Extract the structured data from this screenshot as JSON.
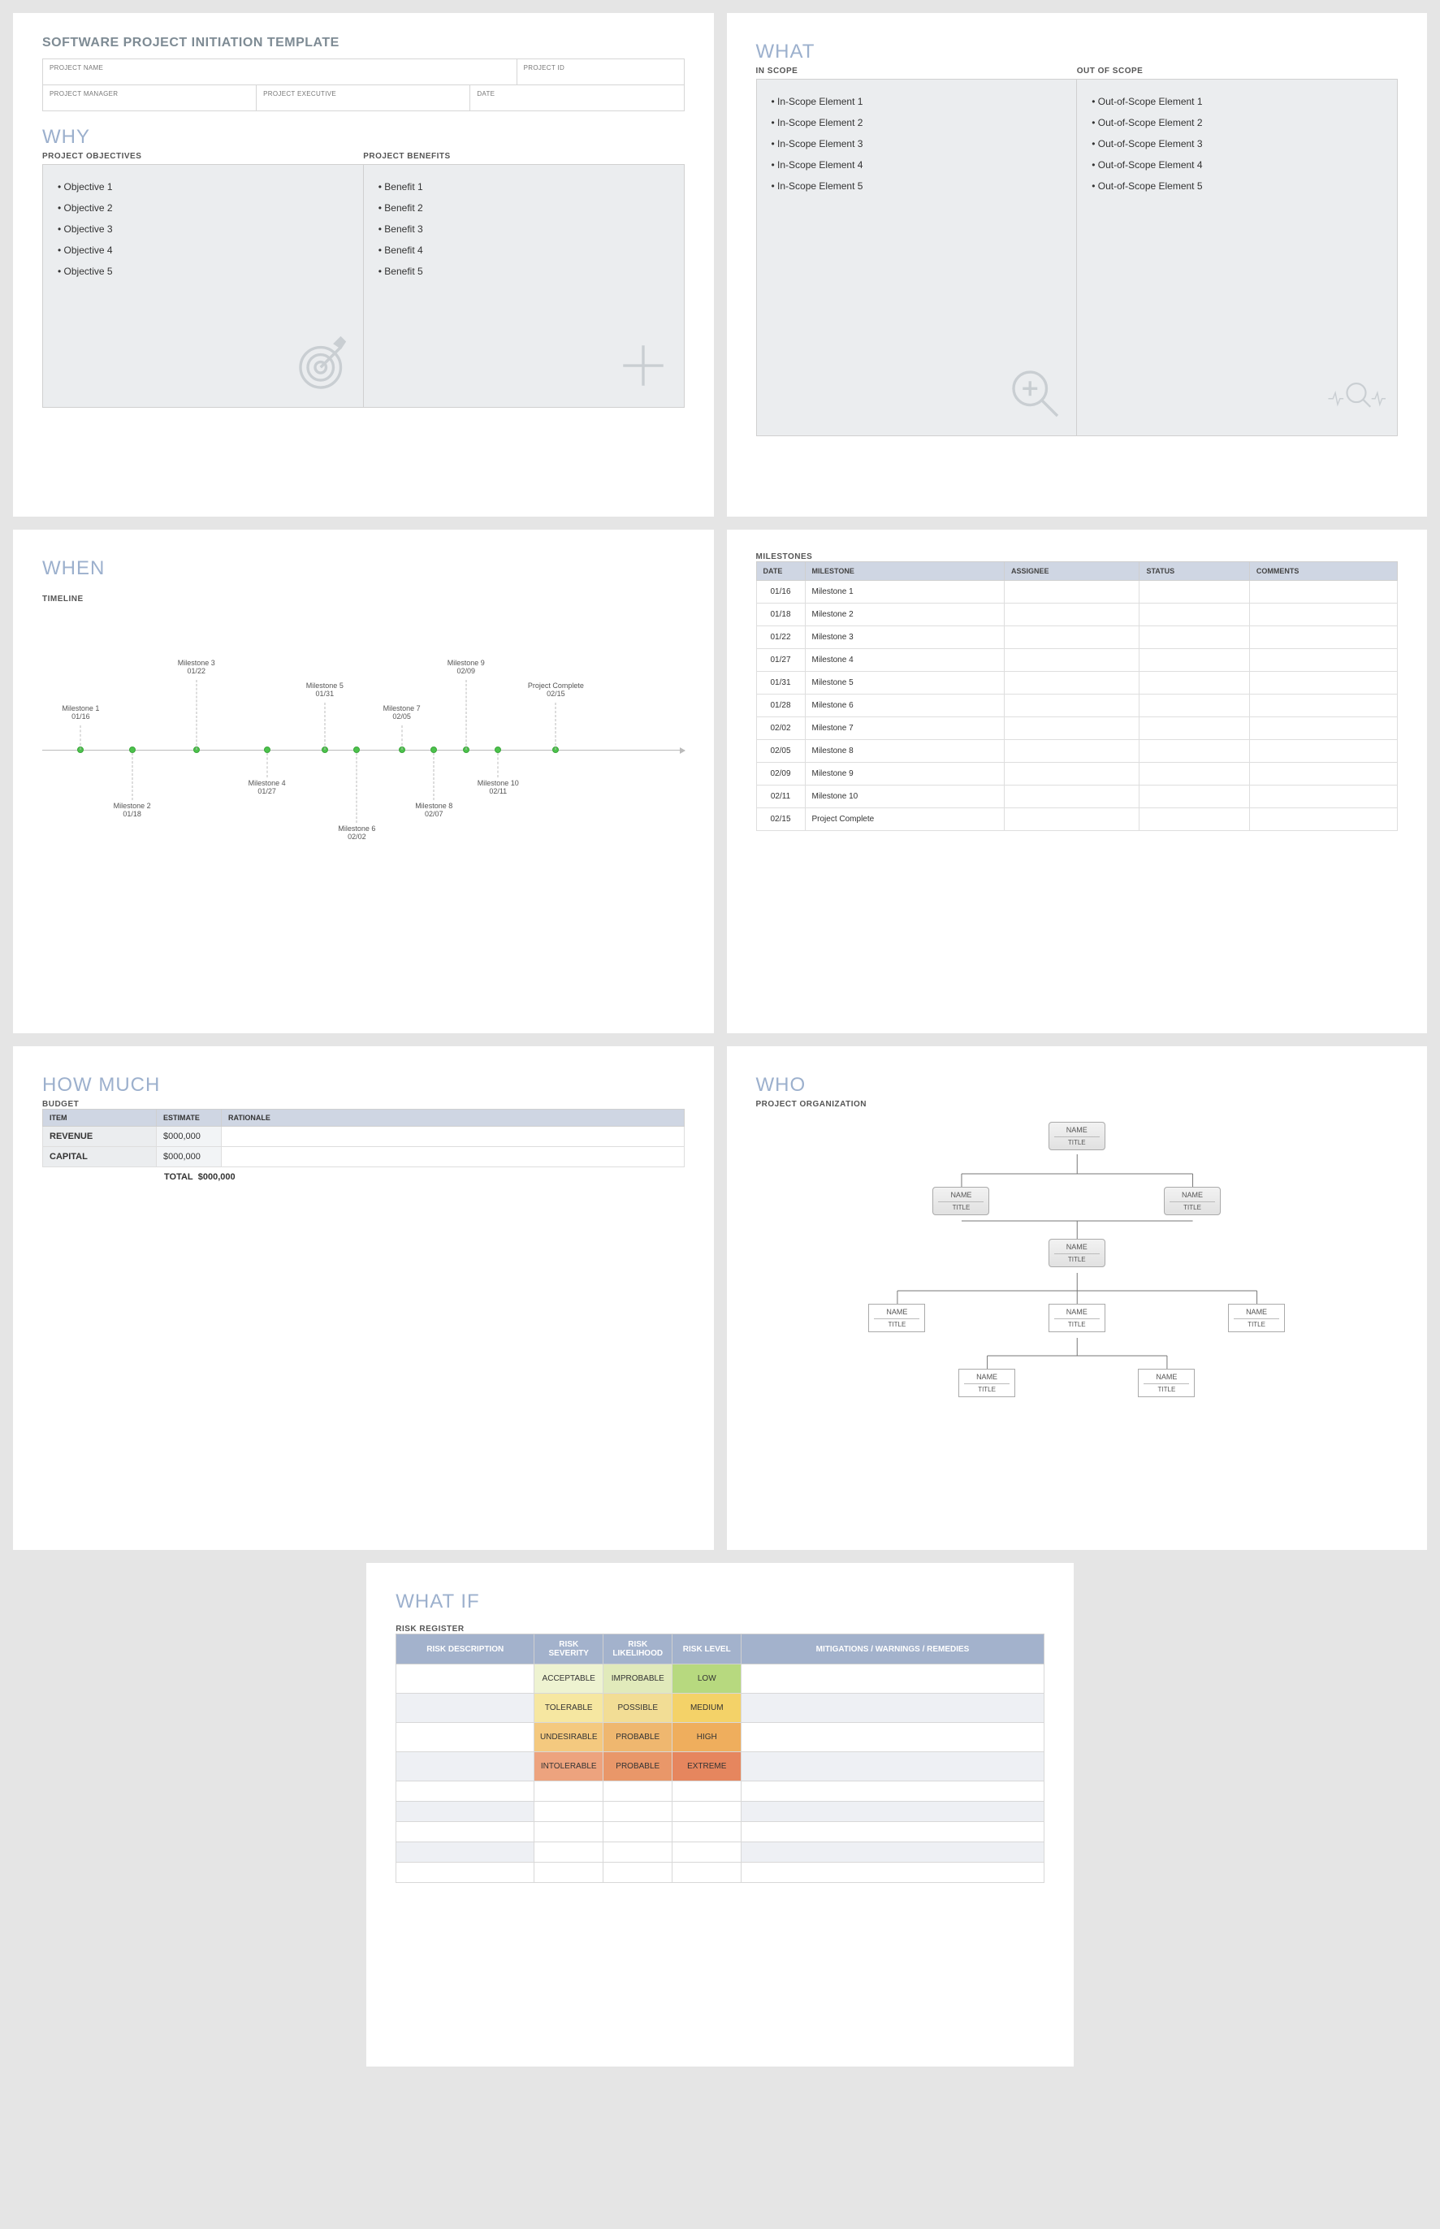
{
  "docTitle": "SOFTWARE PROJECT INITIATION TEMPLATE",
  "hdr": {
    "projectName": "PROJECT NAME",
    "projectId": "PROJECT ID",
    "projectManager": "PROJECT MANAGER",
    "projectExecutive": "PROJECT EXECUTIVE",
    "date": "DATE"
  },
  "why": {
    "title": "WHY",
    "objLabel": "PROJECT OBJECTIVES",
    "benLabel": "PROJECT BENEFITS",
    "objectives": [
      "Objective 1",
      "Objective 2",
      "Objective 3",
      "Objective 4",
      "Objective 5"
    ],
    "benefits": [
      "Benefit 1",
      "Benefit 2",
      "Benefit 3",
      "Benefit 4",
      "Benefit 5"
    ]
  },
  "what": {
    "title": "WHAT",
    "inLabel": "IN SCOPE",
    "outLabel": "OUT OF SCOPE",
    "inscope": [
      "In-Scope Element 1",
      "In-Scope Element 2",
      "In-Scope Element 3",
      "In-Scope Element 4",
      "In-Scope Element 5"
    ],
    "outscope": [
      "Out-of-Scope Element 1",
      "Out-of-Scope Element 2",
      "Out-of-Scope Element 3",
      "Out-of-Scope Element 4",
      "Out-of-Scope Element 5"
    ]
  },
  "when": {
    "title": "WHEN",
    "timelineLabel": "TIMELINE",
    "milestonesLabel": "MILESTONES",
    "cols": {
      "date": "DATE",
      "milestone": "MILESTONE",
      "assignee": "ASSIGNEE",
      "status": "STATUS",
      "comments": "COMMENTS"
    },
    "items": [
      {
        "date": "01/16",
        "name": "Milestone 1",
        "pos": 6,
        "side": "up"
      },
      {
        "date": "01/18",
        "name": "Milestone 2",
        "pos": 14,
        "side": "down"
      },
      {
        "date": "01/22",
        "name": "Milestone 3",
        "pos": 24,
        "side": "up"
      },
      {
        "date": "01/27",
        "name": "Milestone 4",
        "pos": 35,
        "side": "down"
      },
      {
        "date": "01/31",
        "name": "Milestone 5",
        "pos": 44,
        "side": "up"
      },
      {
        "date": "02/02",
        "name": "Milestone 6",
        "pos": 49,
        "side": "down"
      },
      {
        "date": "02/05",
        "name": "Milestone 7",
        "pos": 56,
        "side": "up"
      },
      {
        "date": "02/07",
        "name": "Milestone 8",
        "pos": 61,
        "side": "down"
      },
      {
        "date": "02/09",
        "name": "Milestone 9",
        "pos": 66,
        "side": "up"
      },
      {
        "date": "02/11",
        "name": "Milestone 10",
        "pos": 71,
        "side": "down"
      },
      {
        "date": "02/15",
        "name": "Project Complete",
        "pos": 80,
        "side": "up"
      }
    ]
  },
  "howmuch": {
    "title": "HOW MUCH",
    "budgetLabel": "BUDGET",
    "cols": {
      "item": "ITEM",
      "estimate": "ESTIMATE",
      "rationale": "RATIONALE"
    },
    "rows": [
      {
        "item": "REVENUE",
        "estimate": "$000,000",
        "rationale": ""
      },
      {
        "item": "CAPITAL",
        "estimate": "$000,000",
        "rationale": ""
      }
    ],
    "totalLabel": "TOTAL",
    "totalValue": "$000,000"
  },
  "who": {
    "title": "WHO",
    "orgLabel": "PROJECT ORGANIZATION",
    "name": "NAME",
    "ttl": "TITLE"
  },
  "whatif": {
    "title": "WHAT IF",
    "regLabel": "RISK REGISTER",
    "cols": {
      "desc": "RISK DESCRIPTION",
      "sev": "RISK SEVERITY",
      "lik": "RISK LIKELIHOOD",
      "lvl": "RISK LEVEL",
      "mit": "MITIGATIONS / WARNINGS / REMEDIES"
    },
    "rows": [
      {
        "sev": "ACCEPTABLE",
        "sevc": "sev-acc",
        "lik": "IMPROBABLE",
        "likc": "lik-imp",
        "lvl": "LOW",
        "lvlc": "lvl-low"
      },
      {
        "sev": "TOLERABLE",
        "sevc": "sev-tol",
        "lik": "POSSIBLE",
        "likc": "lik-pos",
        "lvl": "MEDIUM",
        "lvlc": "lvl-med"
      },
      {
        "sev": "UNDESIRABLE",
        "sevc": "sev-und",
        "lik": "PROBABLE",
        "likc": "lik-pro1",
        "lvl": "HIGH",
        "lvlc": "lvl-hig"
      },
      {
        "sev": "INTOLERABLE",
        "sevc": "sev-int",
        "lik": "PROBABLE",
        "likc": "lik-pro2",
        "lvl": "EXTREME",
        "lvlc": "lvl-ext"
      }
    ],
    "emptyRows": 5
  },
  "chart_data": {
    "type": "table",
    "title": "MILESTONES",
    "columns": [
      "DATE",
      "MILESTONE"
    ],
    "rows": [
      [
        "01/16",
        "Milestone 1"
      ],
      [
        "01/18",
        "Milestone 2"
      ],
      [
        "01/22",
        "Milestone 3"
      ],
      [
        "01/27",
        "Milestone 4"
      ],
      [
        "01/31",
        "Milestone 5"
      ],
      [
        "01/28",
        "Milestone 6"
      ],
      [
        "02/02",
        "Milestone 7"
      ],
      [
        "02/05",
        "Milestone 8"
      ],
      [
        "02/09",
        "Milestone 9"
      ],
      [
        "02/11",
        "Milestone 10"
      ],
      [
        "02/15",
        "Project Complete"
      ]
    ]
  }
}
